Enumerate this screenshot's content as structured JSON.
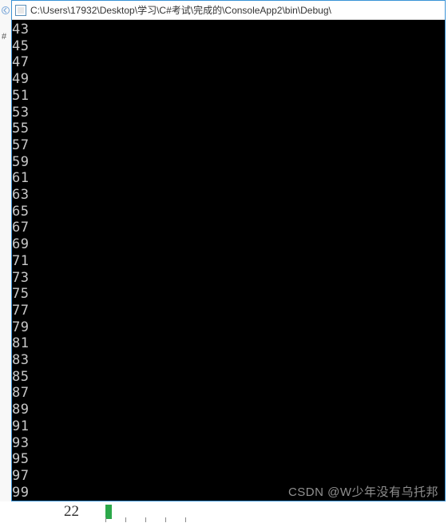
{
  "titlebar": {
    "path": "C:\\Users\\17932\\Desktop\\学习\\C#考试\\完成的\\ConsoleApp2\\bin\\Debug\\"
  },
  "console": {
    "lines": [
      "43",
      "45",
      "47",
      "49",
      "51",
      "53",
      "55",
      "57",
      "59",
      "61",
      "63",
      "65",
      "67",
      "69",
      "71",
      "73",
      "75",
      "77",
      "79",
      "81",
      "83",
      "85",
      "87",
      "89",
      "91",
      "93",
      "95",
      "97",
      "99"
    ]
  },
  "background": {
    "hash": "#",
    "under_number": "22"
  },
  "watermark": {
    "text": "CSDN @W少年没有乌托邦"
  }
}
